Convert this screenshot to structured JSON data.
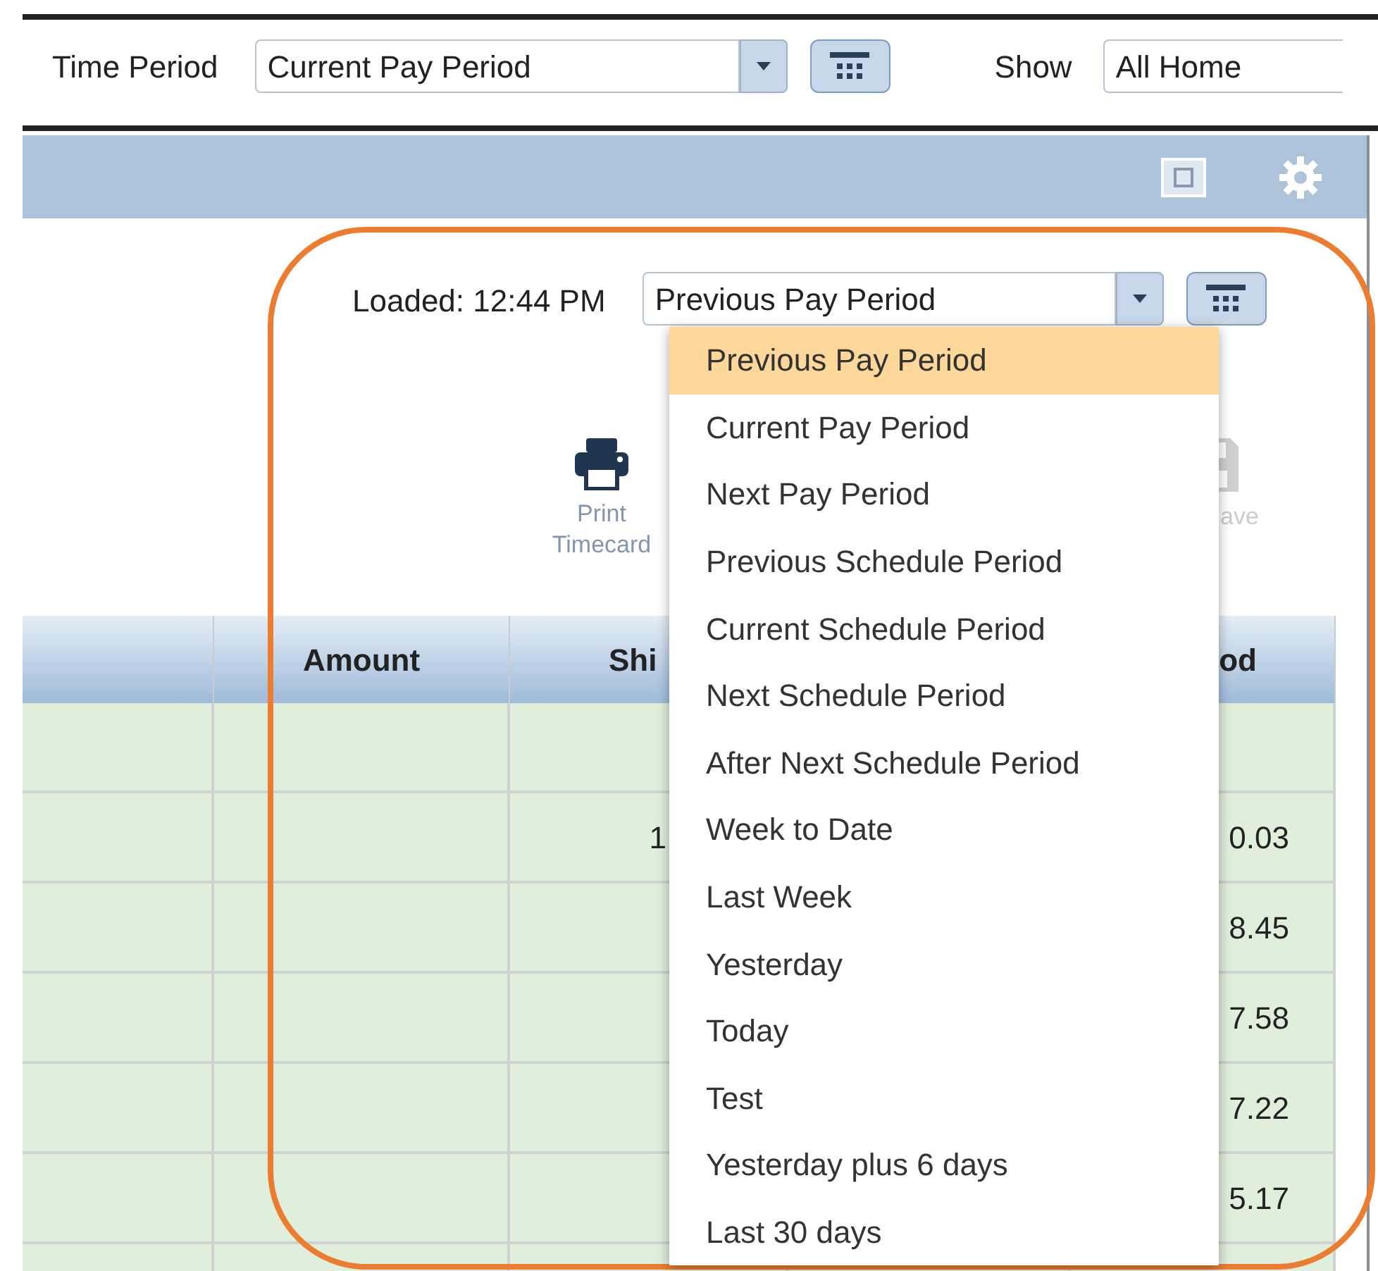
{
  "filter_bar": {
    "time_period_label": "Time Period",
    "time_period": "Current Pay Period",
    "show_label": "Show",
    "show": "All Home"
  },
  "panel": {
    "loaded": "Loaded: 12:44 PM",
    "period_select": "Previous Pay Period",
    "period_options": [
      {
        "label": "Previous Pay Period",
        "selected": true
      },
      {
        "label": "Current Pay Period",
        "selected": false
      },
      {
        "label": "Next Pay Period",
        "selected": false
      },
      {
        "label": "Previous Schedule Period",
        "selected": false
      },
      {
        "label": "Current Schedule Period",
        "selected": false
      },
      {
        "label": "Next Schedule Period",
        "selected": false
      },
      {
        "label": "After Next Schedule Period",
        "selected": false
      },
      {
        "label": "Week to Date",
        "selected": false
      },
      {
        "label": "Last Week",
        "selected": false
      },
      {
        "label": "Yesterday",
        "selected": false
      },
      {
        "label": "Today",
        "selected": false
      },
      {
        "label": "Test",
        "selected": false
      },
      {
        "label": "Yesterday plus 6 days",
        "selected": false
      },
      {
        "label": "Last 30 days",
        "selected": false
      }
    ],
    "toolbar": [
      {
        "kind": "print",
        "label": "Print Timecard",
        "disabled": false
      },
      {
        "kind": "save",
        "label": "ave",
        "disabled": true
      }
    ],
    "table": {
      "columns": {
        "column_2": "Amount",
        "column_3": "Shi",
        "column_5": "od"
      },
      "rows": [
        {},
        {
          "column_3": "1",
          "column_5": "0.03"
        },
        {
          "column_5": "8.45"
        },
        {
          "column_5": "7.58"
        },
        {
          "column_5": "7.22"
        },
        {
          "column_5": "5.17"
        },
        {}
      ]
    }
  }
}
